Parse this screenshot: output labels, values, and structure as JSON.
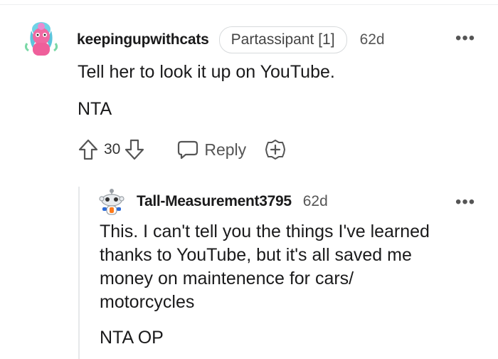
{
  "comment": {
    "username": "keepingupwithcats",
    "flair": "Partassipant [1]",
    "age": "62d",
    "more": "•••",
    "body": [
      "Tell her to look it up on YouTube.",
      "NTA"
    ],
    "score": "30",
    "reply_label": "Reply"
  },
  "reply": {
    "username": "Tall-Measurement3795",
    "age": "62d",
    "more": "•••",
    "body": [
      "This. I can't tell you the things I've learned",
      "thanks to YouTube, but it's all saved me",
      "money on maintenence for cars/",
      "motorcycles",
      "NTA OP"
    ]
  }
}
